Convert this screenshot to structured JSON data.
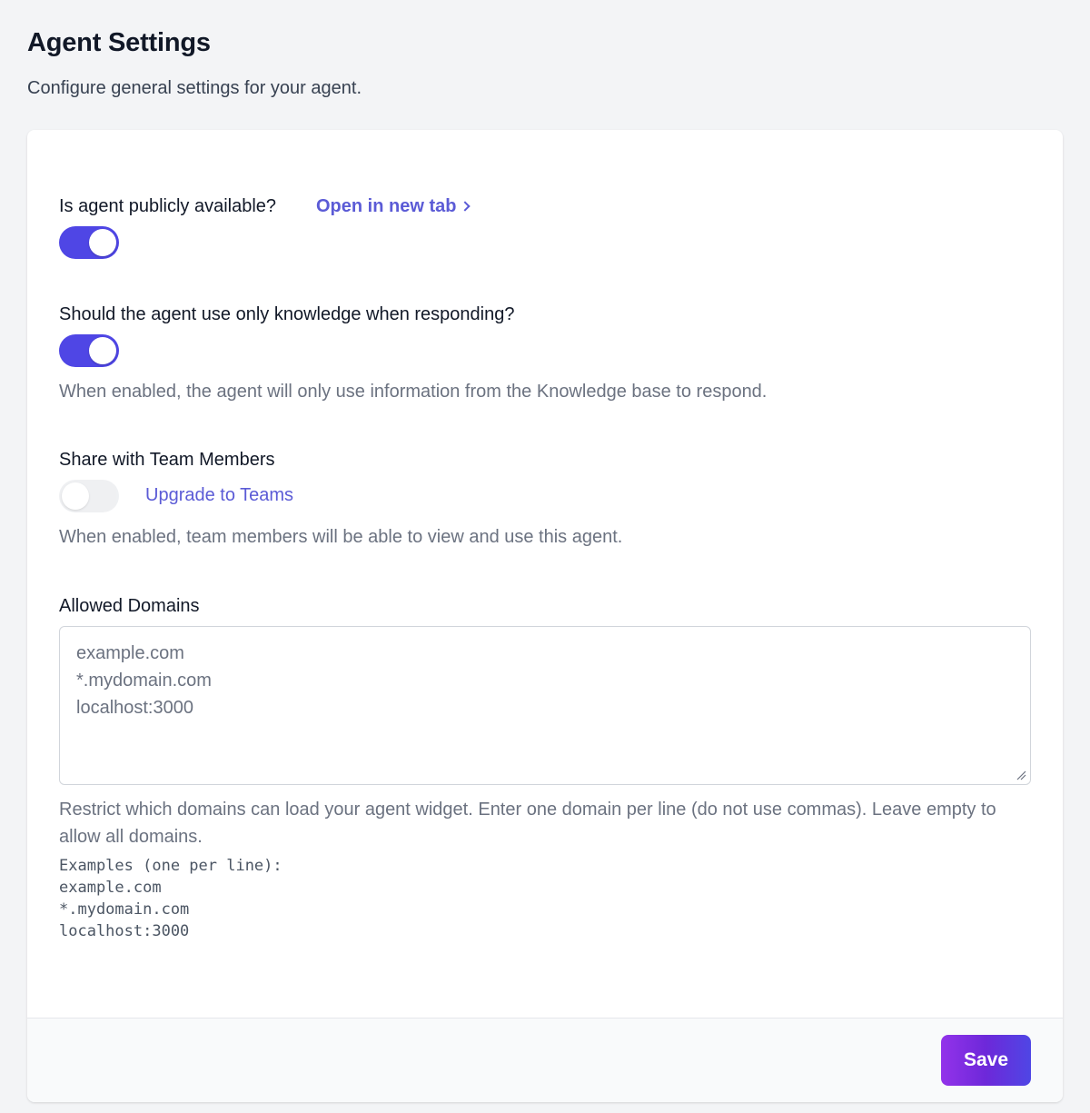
{
  "page": {
    "title": "Agent Settings",
    "subtitle": "Configure general settings for your agent."
  },
  "public_setting": {
    "label": "Is agent publicly available?",
    "link_label": "Open in new tab",
    "enabled": true
  },
  "knowledge_setting": {
    "label": "Should the agent use only knowledge when responding?",
    "enabled": true,
    "help": "When enabled, the agent will only use information from the Knowledge base to respond."
  },
  "team_setting": {
    "label": "Share with Team Members",
    "enabled": false,
    "upgrade_label": "Upgrade to Teams",
    "help": "When enabled, team members will be able to view and use this agent."
  },
  "domains_setting": {
    "label": "Allowed Domains",
    "placeholder_lines": [
      "example.com",
      "*.mydomain.com",
      "localhost:3000"
    ],
    "help": "Restrict which domains can load your agent widget. Enter one domain per line (do not use commas). Leave empty to allow all domains.",
    "examples_title": "Examples (one per line):",
    "examples": [
      "example.com",
      "*.mydomain.com",
      "localhost:3000"
    ]
  },
  "footer": {
    "save_label": "Save"
  },
  "colors": {
    "accent": "#4f46e5",
    "link": "#5b5bd6",
    "save_gradient_start": "#9333ea",
    "save_gradient_end": "#4f46e5"
  }
}
